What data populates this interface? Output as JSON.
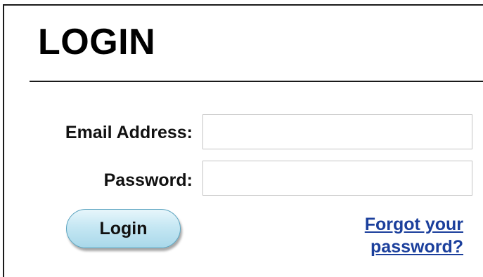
{
  "header": {
    "title": "LOGIN"
  },
  "form": {
    "email_label": "Email Address:",
    "email_value": "",
    "password_label": "Password:",
    "password_value": "",
    "login_button_label": "Login",
    "forgot_link_line1": "Forgot your",
    "forgot_link_line2": "password?"
  },
  "colors": {
    "link": "#1b3f9c",
    "button_border": "#5aa3bf",
    "button_fill": "#c5e7f3",
    "divider": "#1a1a1a"
  }
}
